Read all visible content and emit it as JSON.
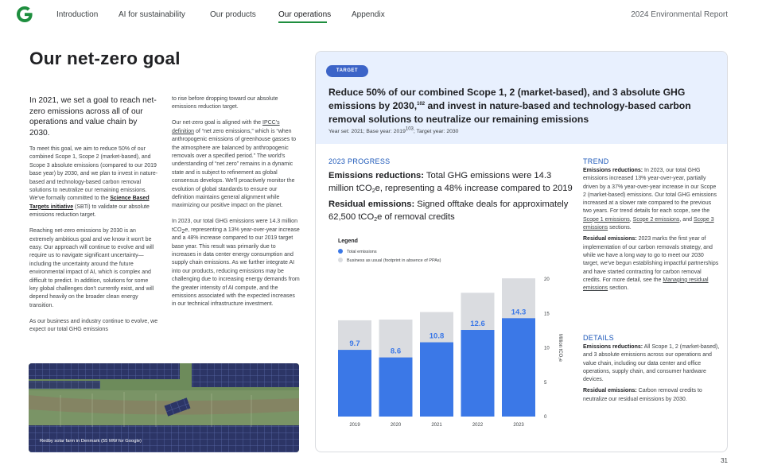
{
  "header": {
    "nav": [
      "Introduction",
      "AI for sustainability",
      "Our products",
      "Our operations",
      "Appendix"
    ],
    "active_nav": "Our operations",
    "report_title": "2024 Environmental Report"
  },
  "page": {
    "title": "Our net-zero goal",
    "page_number": "31"
  },
  "left_column": {
    "lead": "In 2021, we set a goal to reach net-zero emissions across all of our operations and value chain by 2030.",
    "p1_a": "To meet this goal, we aim to reduce 50% of our combined Scope 1, Scope 2 (market-based), and Scope 3 absolute emissions (compared to our 2019 base year) by 2030, and we plan to invest in nature-based and technology-based carbon removal solutions to neutralize our remaining emissions. We've formally committed to the ",
    "p1_link": "Science Based Targets initiative",
    "p1_b": " (SBTi) to validate our absolute emissions reduction target.",
    "p2": "Reaching net-zero emissions by 2030 is an extremely ambitious goal and we know it won't be easy. Our approach will continue to evolve and will require us to navigate significant uncertainty—including the uncertainty around the future environmental impact of AI, which is complex and difficult to predict. In addition, solutions for some key global challenges don't currently exist, and will depend heavily on the broader clean energy transition.",
    "p3": "As our business and industry continue to evolve, we expect our total GHG emissions"
  },
  "middle_column": {
    "p1": "to rise before dropping toward our absolute emissions reduction target.",
    "p2_link": "IPCC's definition",
    "p2_a": "Our net-zero goal is aligned with the ",
    "p2_b": " of “net zero emissions,” which is “when anthropogenic emissions of greenhouse gasses to the atmosphere are balanced by anthropogenic removals over a specified period.” The world's understanding of “net zero” remains in a dynamic state and is subject to refinement as global consensus develops. We'll proactively monitor the evolution of global standards to ensure our definition maintains general alignment while maximizing our positive impact on the planet.",
    "p3_a": "In 2023, our total GHG emissions were 14.3 million tCO",
    "p3_sub": "2",
    "p3_b": "e, representing a 13% year-over-year increase and a 48% increase compared to our 2019 target base year. This result was primarily due to increases in data center energy consumption and supply chain emissions. As we further integrate AI into our products, reducing emissions may be challenging due to increasing energy demands from the greater intensity of AI compute, and the emissions associated with the expected increases in our technical infrastructure investment."
  },
  "photo": {
    "caption": "Redby solar farm in Denmark (55 MW for Google)"
  },
  "target_card": {
    "badge": "TARGET",
    "text_a": "Reduce 50% of our combined Scope 1, 2 (market-based), and 3 absolute GHG emissions by 2030,",
    "text_sup": "102",
    "text_b": " and invest in nature-based and technology-based carbon removal solutions to neutralize our remaining emissions",
    "years_a": "Year set: 2021; Base year: 2019",
    "years_sup": "103",
    "years_b": "; Target year: 2030",
    "progress_heading": "2023 PROGRESS",
    "emissions_label": "Emissions reductions:",
    "emissions_text_a": " Total GHG emissions were 14.3 million tCO",
    "emissions_sub": "2",
    "emissions_text_b": "e, representing a 48% increase compared to 2019",
    "residual_label": "Residual emissions:",
    "residual_text_a": " Signed offtake deals for approximately 62,500 tCO",
    "residual_sub": "2",
    "residual_text_b": "e of removal credits",
    "legend_title": "Legend",
    "legend_total": "Total emissions",
    "legend_bau": "Business as usual (footprint in absence of PPAs)",
    "trend_heading": "TREND",
    "trend_p1_label": "Emissions reductions:",
    "trend_p1_a": " In 2023, our total GHG emissions increased 13% year-over-year, partially driven by a 37% year-over-year increase in our Scope 2 (market-based) emissions. Our total GHG emissions increased at a slower rate compared to the previous two years. For trend details for each scope, see the ",
    "trend_link1": "Scope 1 emissions",
    "trend_sep1": ", ",
    "trend_link2": "Scope 2 emissions",
    "trend_sep2": ", and ",
    "trend_link3": "Scope 3 emissions",
    "trend_p1_b": " sections.",
    "trend_p2_label": "Residual emissions:",
    "trend_p2_a": " 2023 marks the first year of implementation of our carbon removals strategy, and while we have a long way to go to meet our 2030 target, we've begun establishing impactful partnerships and have started contracting for carbon removal credits. For more detail, see the ",
    "trend_link4": "Managing residual emissions",
    "trend_p2_b": " section.",
    "details_heading": "DETAILS",
    "details_p1_label": "Emissions reductions:",
    "details_p1": " All Scope 1, 2 (market-based), and 3 absolute emissions across our operations and value chain, including our data center and office operations, supply chain, and consumer hardware devices.",
    "details_p2_label": "Residual emissions:",
    "details_p2": " Carbon removal credits to neutralize our residual emissions by 2030."
  },
  "colors": {
    "total": "#3b78e7",
    "bau": "#dadce0",
    "accent": "#1a56b8",
    "nav_underline": "#1e8e3e"
  },
  "chart_data": {
    "type": "bar",
    "categories": [
      "2019",
      "2020",
      "2021",
      "2022",
      "2023"
    ],
    "series": [
      {
        "name": "Total emissions",
        "values": [
          9.7,
          8.6,
          10.8,
          12.6,
          14.3
        ]
      },
      {
        "name": "Business as usual (footprint in absence of PPAs)",
        "values": [
          14.0,
          14.1,
          15.2,
          18.0,
          20.1
        ]
      }
    ],
    "ylabel": "Million tCO₂e",
    "yticks": [
      0,
      5,
      10,
      15,
      20
    ],
    "ylim": [
      0,
      20
    ],
    "data_labels": [
      "9.7",
      "8.6",
      "10.8",
      "12.6",
      "14.3"
    ]
  }
}
